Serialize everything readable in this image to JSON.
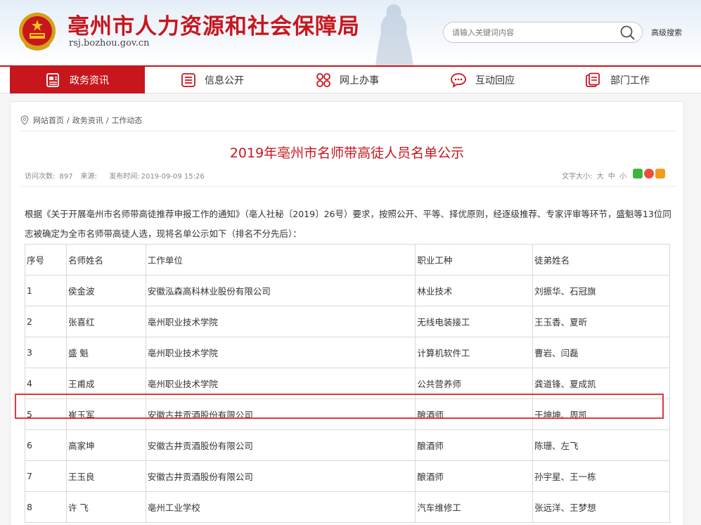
{
  "header": {
    "site_title": "亳州市人力资源和社会保障局",
    "domain": "rsj.bozhou.gov.cn",
    "search_placeholder": "请输入关键词内容",
    "advanced_search": "高级搜索"
  },
  "nav": {
    "items": [
      {
        "label": "政务资讯",
        "icon": "news-icon",
        "active": true
      },
      {
        "label": "信息公开",
        "icon": "list-icon",
        "active": false
      },
      {
        "label": "网上办事",
        "icon": "grid-icon",
        "active": false
      },
      {
        "label": "互动回应",
        "icon": "chat-icon",
        "active": false
      },
      {
        "label": "部门工作",
        "icon": "document-icon",
        "active": false
      }
    ]
  },
  "breadcrumb": {
    "items": [
      "网站首页",
      "政务资讯",
      "工作动态"
    ],
    "separator": "/"
  },
  "article": {
    "title": "2019年亳州市名师带高徒人员名单公示",
    "views_label": "访问次数:",
    "views": "897",
    "source_label": "来源:",
    "publish_label": "发布时间:",
    "publish_time": "2019-09-09 15:26",
    "font_size_label": "文字大小:",
    "font_sizes": [
      "大",
      "中",
      "小"
    ],
    "intro": "根据《关于开展亳州市名师带高徒推荐申报工作的通知》（亳人社秘〔2019〕26号）要求，按照公开、平等、择优原则，经逐级推荐、专家评审等环节，盛魁等13位同志被确定为全市名师带高徒人选，现将名单公示如下（排名不分先后）："
  },
  "table": {
    "headers": [
      "序号",
      "名师姓名",
      "工作单位",
      "职业工种",
      "徒弟姓名"
    ],
    "rows": [
      [
        "1",
        "侯金波",
        "安徽泓森高科林业股份有限公司",
        "林业技术",
        "刘振华、石冠旗"
      ],
      [
        "2",
        "张喜红",
        "亳州职业技术学院",
        "无线电装接工",
        "王玉香、夏昕"
      ],
      [
        "3",
        "盛 魁",
        "亳州职业技术学院",
        "计算机软件工",
        "曹岩、闫磊"
      ],
      [
        "4",
        "王甫成",
        "亳州职业技术学院",
        "公共营养师",
        "龚道锋、夏成凯"
      ],
      [
        "5",
        "崔玉军",
        "安徽古井贡酒股份有限公司",
        "酿酒师",
        "于坤坤、周凯"
      ],
      [
        "6",
        "高家坤",
        "安徽古井贡酒股份有限公司",
        "酿酒师",
        "陈珊、左飞"
      ],
      [
        "7",
        "王玉良",
        "安徽古井贡酒股份有限公司",
        "酿酒师",
        "孙宇星、王一栋"
      ],
      [
        "8",
        "许 飞",
        "亳州工业学校",
        "汽车维修工",
        "张远洋、王梦想"
      ]
    ]
  },
  "colors": {
    "brand_red": "#c8161d",
    "highlight_red": "#e2363f"
  }
}
